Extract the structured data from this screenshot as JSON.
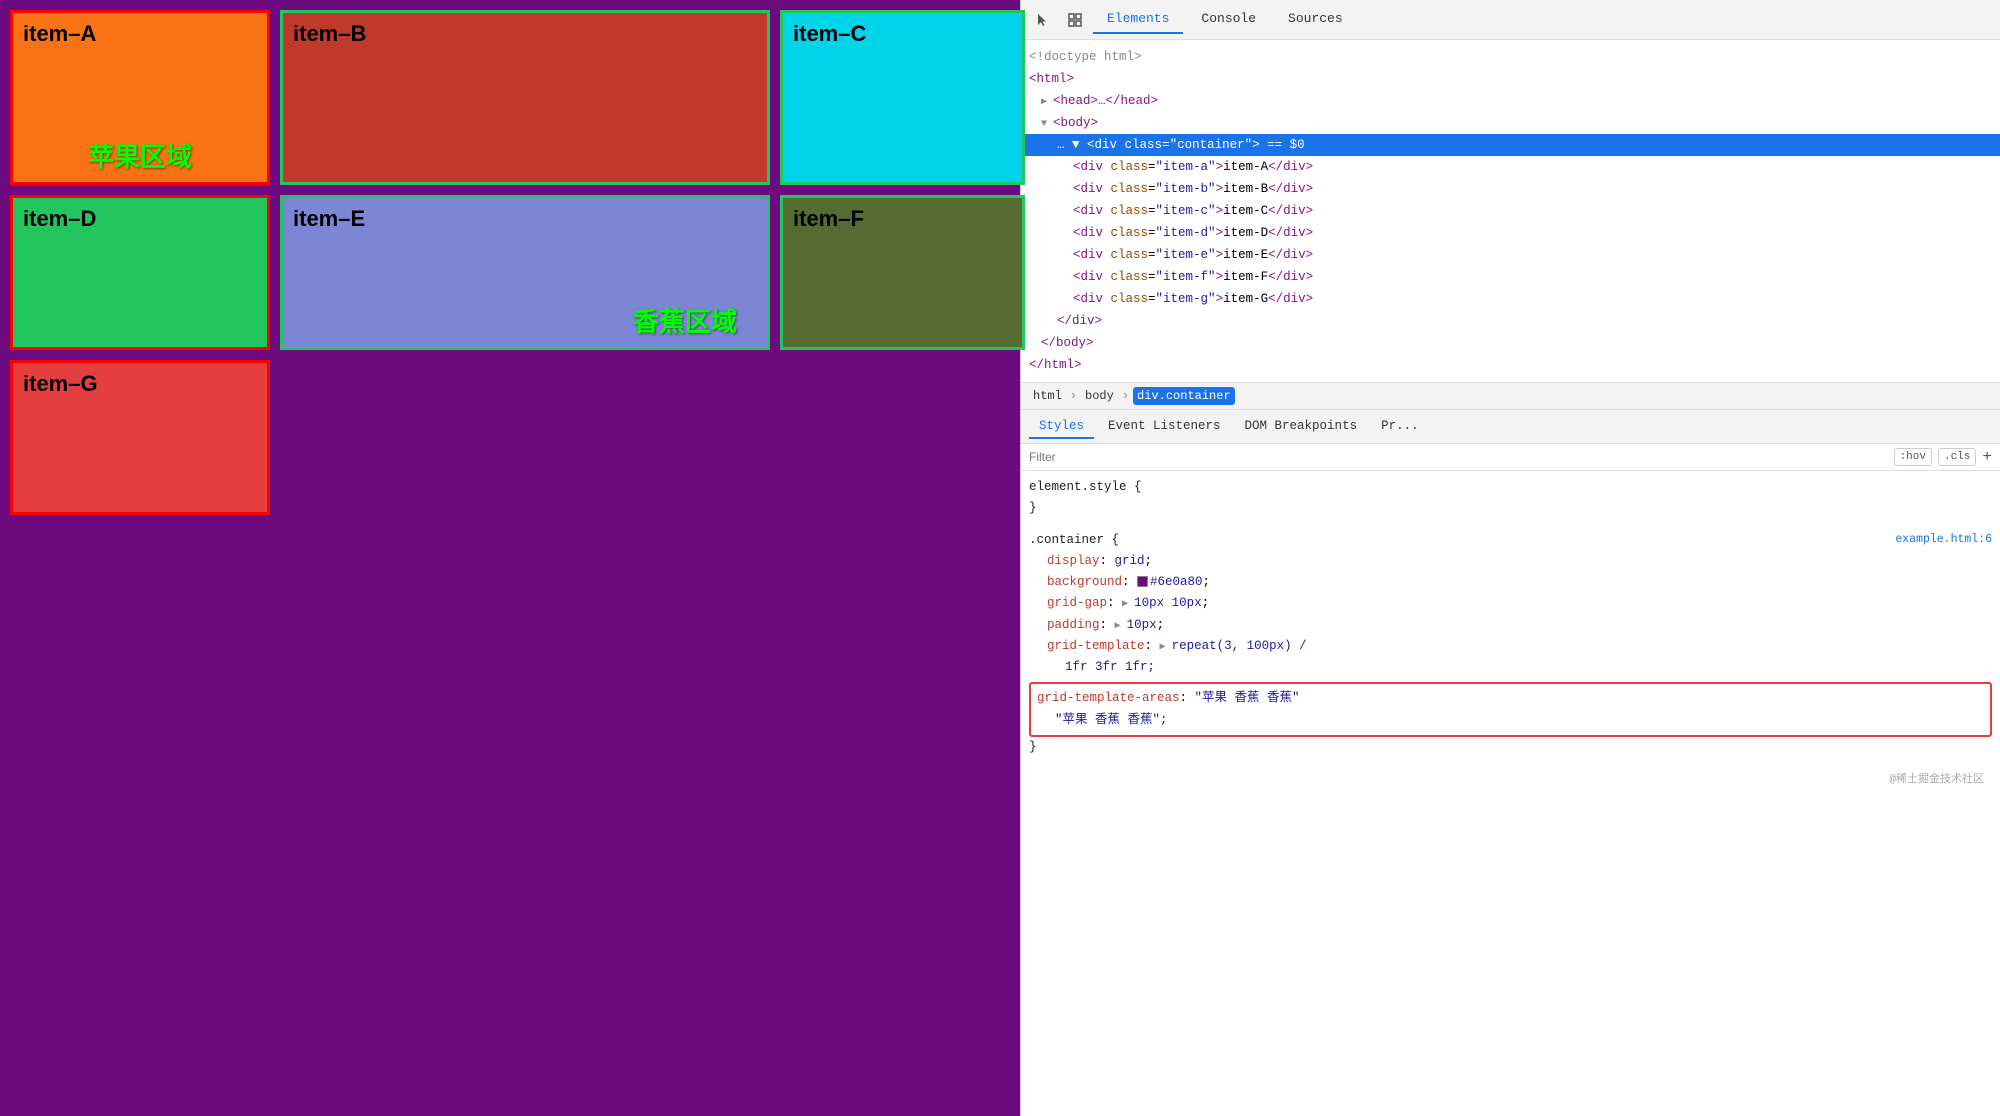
{
  "browser": {
    "items": [
      {
        "id": "item-a",
        "label": "item–A",
        "class": "item-a"
      },
      {
        "id": "item-b",
        "label": "item–B",
        "class": "item-b"
      },
      {
        "id": "item-c",
        "label": "item–C",
        "class": "item-c"
      },
      {
        "id": "item-d",
        "label": "item–D",
        "class": "item-d"
      },
      {
        "id": "item-e",
        "label": "item–E",
        "class": "item-e"
      },
      {
        "id": "item-f",
        "label": "item–F",
        "class": "item-f"
      },
      {
        "id": "item-g",
        "label": "item–G",
        "class": "item-g"
      }
    ],
    "area_apple": "苹果区域",
    "area_banana": "香蕉区域"
  },
  "devtools": {
    "tabs": [
      "Elements",
      "Console",
      "Sources"
    ],
    "active_tab": "Elements",
    "dom": {
      "lines": [
        {
          "text": "<!doctype html>",
          "indent": 0,
          "type": "comment"
        },
        {
          "text": "<html>",
          "indent": 0,
          "type": "tag"
        },
        {
          "text": "▶ <head>…</head>",
          "indent": 1,
          "type": "tag"
        },
        {
          "text": "▼ <body>",
          "indent": 1,
          "type": "tag"
        },
        {
          "text": "… ▼ <div class=\"container\"> == $0",
          "indent": 2,
          "type": "highlighted"
        },
        {
          "text": "<div class=\"item-a\">item-A</div>",
          "indent": 3,
          "type": "tag"
        },
        {
          "text": "<div class=\"item-b\">item-B</div>",
          "indent": 3,
          "type": "tag"
        },
        {
          "text": "<div class=\"item-c\">item-C</div>",
          "indent": 3,
          "type": "tag"
        },
        {
          "text": "<div class=\"item-d\">item-D</div>",
          "indent": 3,
          "type": "tag"
        },
        {
          "text": "<div class=\"item-e\">item-E</div>",
          "indent": 3,
          "type": "tag"
        },
        {
          "text": "<div class=\"item-f\">item-F</div>",
          "indent": 3,
          "type": "tag"
        },
        {
          "text": "<div class=\"item-g\">item-G</div>",
          "indent": 3,
          "type": "tag"
        },
        {
          "text": "</div>",
          "indent": 2,
          "type": "tag"
        },
        {
          "text": "</body>",
          "indent": 1,
          "type": "tag"
        },
        {
          "text": "</html>",
          "indent": 0,
          "type": "tag"
        }
      ]
    },
    "breadcrumbs": [
      "html",
      "body",
      "div.container"
    ],
    "styles_tabs": [
      "Styles",
      "Event Listeners",
      "DOM Breakpoints",
      "Pr..."
    ],
    "active_styles_tab": "Styles",
    "filter_placeholder": "Filter",
    "filter_hov": ":hov",
    "filter_cls": ".cls",
    "filter_plus": "+",
    "style_blocks": [
      {
        "selector": "element.style {",
        "source": "",
        "properties": [],
        "closing": "}"
      },
      {
        "selector": ".container {",
        "source": "example.html:6",
        "properties": [
          {
            "prop": "display",
            "colon": ":",
            "value": "grid",
            "semi": ";"
          },
          {
            "prop": "background",
            "colon": ":",
            "value": "#6e0a80",
            "semi": ";",
            "has_swatch": true,
            "swatch_color": "#6e0a80"
          },
          {
            "prop": "grid-gap",
            "colon": ":",
            "value": "10px 10px",
            "semi": ";",
            "has_arrow": true
          },
          {
            "prop": "padding",
            "colon": ":",
            "value": "10px",
            "semi": ";",
            "has_arrow": true
          },
          {
            "prop": "grid-template",
            "colon": ":",
            "value": "repeat(3, 100px) /",
            "semi": "",
            "has_arrow": true
          },
          {
            "prop": "",
            "colon": "",
            "value": "1fr 3fr 1fr;",
            "semi": ""
          }
        ],
        "closing": ""
      }
    ],
    "highlighted_rule": {
      "prop": "grid-template-areas",
      "colon": ":",
      "value1": "\"苹果 香蕉 香蕉\"",
      "value2": "\"苹果 香蕉 香蕉\";"
    },
    "watermark": "@稀土掘金技术社区"
  }
}
